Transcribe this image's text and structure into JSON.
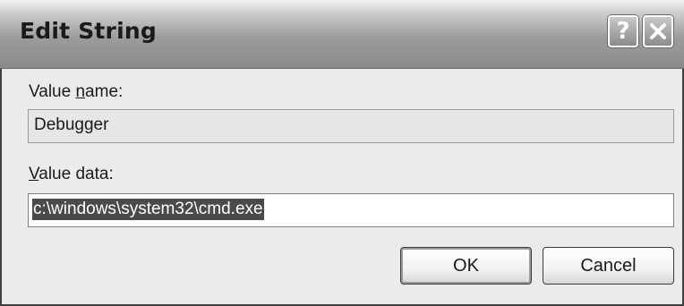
{
  "window": {
    "title": "Edit String",
    "help_glyph": "?",
    "close_icon": "close-icon"
  },
  "form": {
    "value_name_label_pre": "Value ",
    "value_name_label_accel": "n",
    "value_name_label_post": "ame:",
    "value_name": "Debugger",
    "value_data_label_accel": "V",
    "value_data_label_post": "alue data:",
    "value_data": "c:\\windows\\system32\\cmd.exe",
    "value_data_selected": true
  },
  "buttons": {
    "ok_label": "OK",
    "cancel_label": "Cancel"
  }
}
